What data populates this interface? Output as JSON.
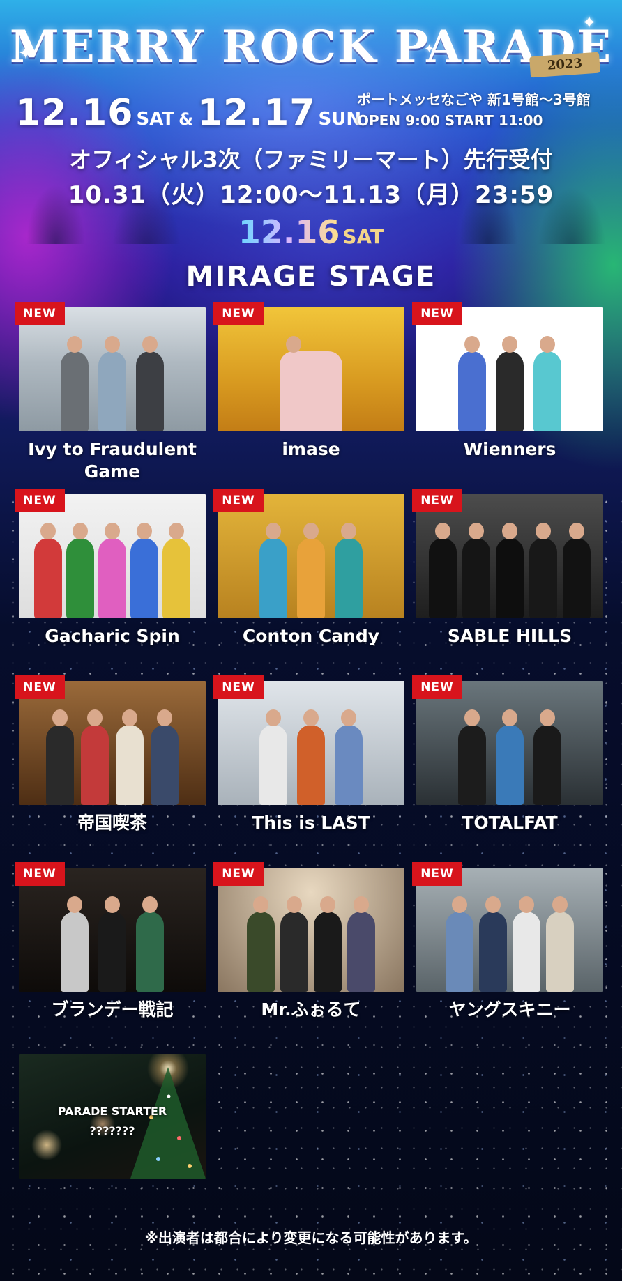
{
  "header": {
    "logo_text": "MERRY ROCK PARADE",
    "year_badge": "2023",
    "date1": "12.16",
    "day1": "SAT",
    "amp": "&",
    "date2": "12.17",
    "day2": "SUN",
    "venue_line1": "ポートメッセなごや 新1号館～3号館",
    "venue_line2": "OPEN 9:00 START 11:00",
    "sale_title": "オフィシャル3次（ファミリーマート）先行受付",
    "sale_period": "10.31（火）12:00～11.13（月）23:59"
  },
  "day_label": {
    "date": "12.16",
    "day": "SAT"
  },
  "stage_title": "MIRAGE STAGE",
  "badge_text": "NEW",
  "artists": [
    {
      "name": "Ivy to Fraudulent Game",
      "new": true,
      "palette": [
        "#b7c3cc",
        "#8c99a3"
      ]
    },
    {
      "name": "imase",
      "new": true,
      "palette": [
        "#e9b22c",
        "#c98a1a"
      ]
    },
    {
      "name": "Wienners",
      "new": true,
      "palette": [
        "#ffffff",
        "#f4f4f4"
      ]
    },
    {
      "name": "Gacharic Spin",
      "new": true,
      "palette": [
        "#eeeeee",
        "#dcdcdc"
      ]
    },
    {
      "name": "Conton Candy",
      "new": true,
      "palette": [
        "#d9a531",
        "#b77c20"
      ]
    },
    {
      "name": "SABLE HILLS",
      "new": true,
      "palette": [
        "#4a4a4a",
        "#262626"
      ]
    },
    {
      "name": "帝国喫茶",
      "new": true,
      "palette": [
        "#8a5a30",
        "#5a3618"
      ]
    },
    {
      "name": "This is LAST",
      "new": true,
      "palette": [
        "#cfd6dc",
        "#9fa8b0"
      ]
    },
    {
      "name": "TOTALFAT",
      "new": true,
      "palette": [
        "#5e6a70",
        "#2e3438"
      ]
    },
    {
      "name": "ブランデー戦記",
      "new": true,
      "palette": [
        "#2a2622",
        "#120f0c"
      ]
    },
    {
      "name": "Mr.ふぉるて",
      "new": true,
      "palette": [
        "#c9b9a0",
        "#8e7b64"
      ]
    },
    {
      "name": "ヤングスキニー",
      "new": true,
      "palette": [
        "#8f9aa0",
        "#5c666b"
      ]
    }
  ],
  "starter": {
    "line1": "PARADE STARTER",
    "line2": "???????"
  },
  "footer_note": "※出演者は都合により変更になる可能性があります。"
}
